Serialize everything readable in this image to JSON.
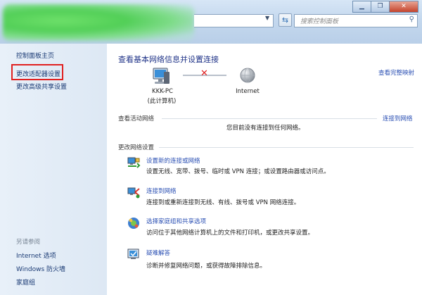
{
  "toolbar": {
    "search_placeholder": "搜索控制面板",
    "refresh_icon": "refresh-icon",
    "search_icon": "magnifier-icon"
  },
  "window_buttons": [
    "minimize",
    "maximize",
    "close"
  ],
  "sidebar": {
    "items": [
      "控制面板主页",
      "更改适配器设置",
      "更改高级共享设置"
    ],
    "highlighted_item": "更改适配器设置",
    "see_also_title": "另请参阅",
    "see_also": [
      "Internet 选项",
      "Windows 防火墙",
      "家庭组"
    ]
  },
  "main": {
    "title": "查看基本网络信息并设置连接",
    "full_map": "查看完整映射",
    "network_map": {
      "computer_name": "KKK-PC",
      "computer_note": "(此计算机)",
      "internet": "Internet"
    },
    "active_networks": {
      "title": "查看活动网络",
      "connect_link": "连接到网络",
      "status": "您目前没有连接到任何网络。"
    },
    "change_settings": {
      "title": "更改网络设置",
      "tasks": [
        {
          "link": "设置新的连接或网络",
          "desc": "设置无线、宽带、拨号、临时或 VPN 连接；或设置路由器或访问点。",
          "icon": "new-connection-icon"
        },
        {
          "link": "连接到网络",
          "desc": "连接到或重新连接到无线、有线、拨号或 VPN 网络连接。",
          "icon": "connect-network-icon"
        },
        {
          "link": "选择家庭组和共享选项",
          "desc": "访问位于其他网络计算机上的文件和打印机，或更改共享设置。",
          "icon": "homegroup-icon"
        },
        {
          "link": "疑难解答",
          "desc": "诊断并修复网络问题，或获得故障排除信息。",
          "icon": "troubleshoot-icon"
        }
      ]
    }
  },
  "colors": {
    "link": "#2a4fb3",
    "title": "#1e3287",
    "highlight_box": "#e02020",
    "sidebar_bg": "#e3ecf7"
  }
}
